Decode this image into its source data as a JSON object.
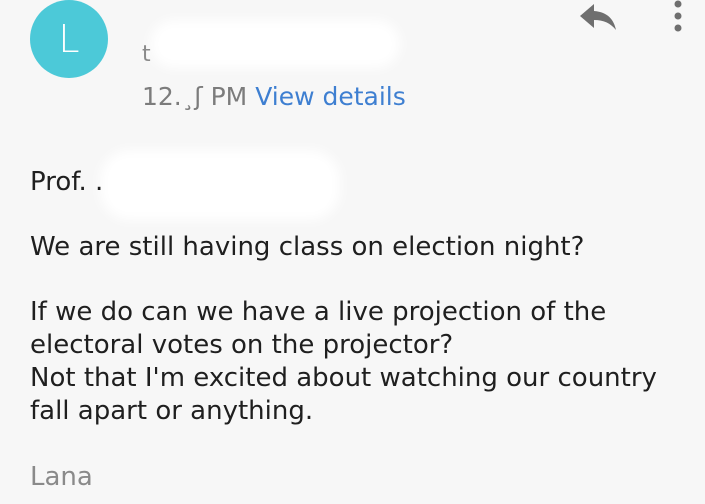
{
  "sender": {
    "avatar_letter": "L",
    "avatar_color": "#4cc9d8",
    "name_partial": "t",
    "time": "12.¸ʃ PM",
    "view_details_label": "View details"
  },
  "toolbar": {
    "reply_icon": "reply-icon",
    "more_icon": "more-vertical-icon"
  },
  "message": {
    "greeting": "Prof. .",
    "line1": "We are still having class on election night?",
    "line2": "If we do can we have a live projection of the electoral votes on the projector?",
    "line3": "Not that I'm excited about watching our country fall apart or anything.",
    "signature": "Lana"
  },
  "colors": {
    "link": "#3e7fd1",
    "background": "#f7f7f7",
    "text": "#1f1f1f",
    "muted": "#8a8a8a"
  }
}
